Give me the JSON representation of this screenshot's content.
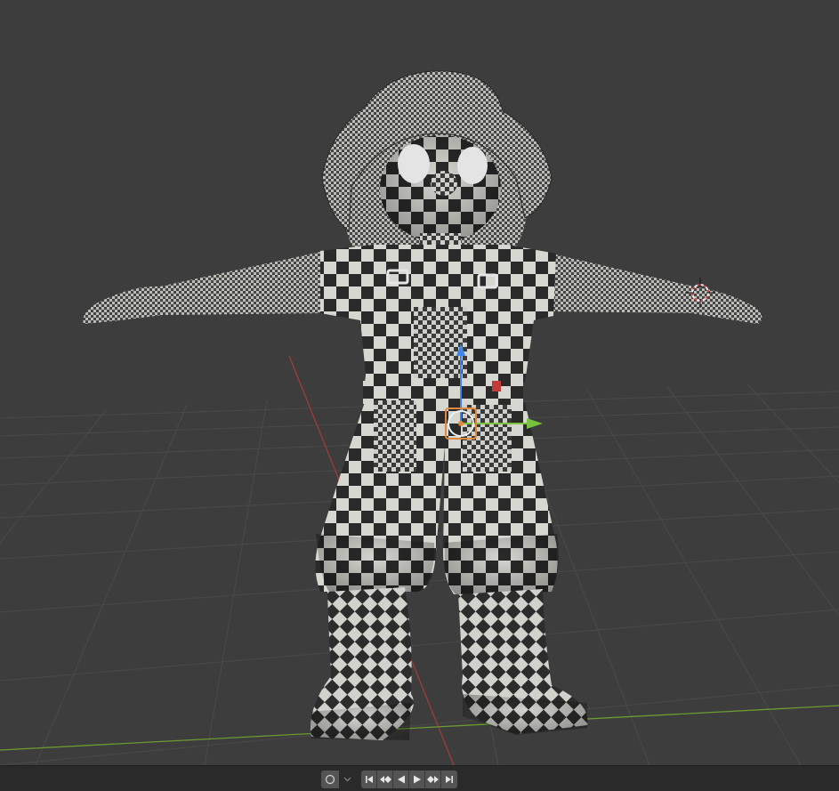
{
  "viewport": {
    "name": "3D Viewport",
    "object": "character-mesh",
    "material_pattern": "checker",
    "colors": {
      "background": "#3d3d3d",
      "grid": "#4a4a4a",
      "x_axis": "#a13a3a",
      "y_axis": "#6c9a32",
      "gizmo_z": "#3f86e6",
      "gizmo_y": "#79c23d",
      "origin": "#e0893a",
      "cursor": "#d44444"
    }
  },
  "timeline": {
    "keying_icon": "circle-icon",
    "dropdown_icon": "chevron-down-icon",
    "controls": [
      {
        "name": "jump-to-start-button",
        "icon": "jump-start-icon"
      },
      {
        "name": "jump-to-prev-keyframe-button",
        "icon": "prev-keyframe-icon"
      },
      {
        "name": "play-reverse-button",
        "icon": "play-reverse-icon"
      },
      {
        "name": "play-button",
        "icon": "play-icon"
      },
      {
        "name": "jump-to-next-keyframe-button",
        "icon": "next-keyframe-icon"
      },
      {
        "name": "jump-to-end-button",
        "icon": "jump-end-icon"
      }
    ]
  }
}
